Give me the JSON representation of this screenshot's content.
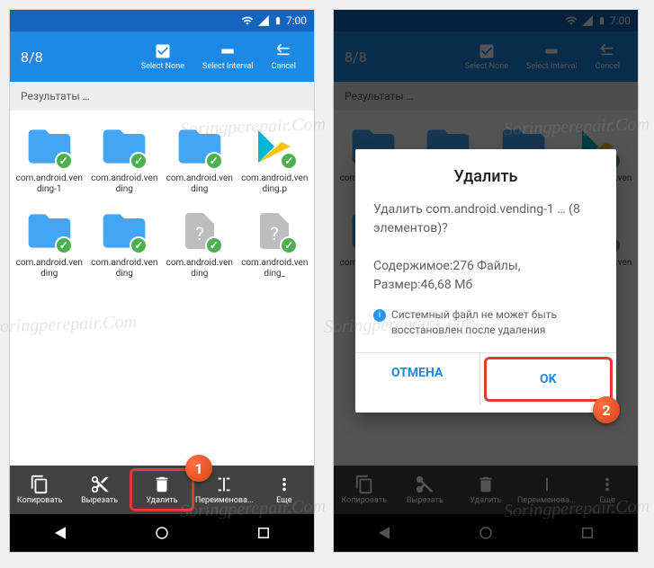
{
  "status": {
    "time": "7:00"
  },
  "appbar": {
    "count": "8/8",
    "select_none": "Select None",
    "select_interval": "Select Interval",
    "cancel": "Cancel"
  },
  "breadcrumb": "Результаты …",
  "files": [
    {
      "name": "com.android.vending-1",
      "type": "folder"
    },
    {
      "name": "com.android.vending",
      "type": "folder"
    },
    {
      "name": "com.android.vending",
      "type": "folder"
    },
    {
      "name": "com.android.vending.p",
      "type": "play"
    },
    {
      "name": "com.android.vending",
      "type": "folder"
    },
    {
      "name": "com.android.vending",
      "type": "folder"
    },
    {
      "name": "com.android.vending",
      "type": "file"
    },
    {
      "name": "com.android.vending_",
      "type": "file"
    }
  ],
  "toolbar": {
    "copy": "Копировать",
    "cut": "Вырезать",
    "delete": "Удалить",
    "rename": "Переименова...",
    "more": "Еще"
  },
  "dialog": {
    "title": "Удалить",
    "question": "Удалить com.android.vending-1 … (8 элементов)?",
    "content_files": "Содержимое:276 Файлы,",
    "content_size": "Размер:46,68 Мб",
    "warning": "Системный файл не может быть восстановлен после удаления",
    "cancel": "Отмена",
    "ok": "OK"
  },
  "steps": {
    "one": "1",
    "two": "2"
  },
  "watermark": "Soringperepair.Com"
}
